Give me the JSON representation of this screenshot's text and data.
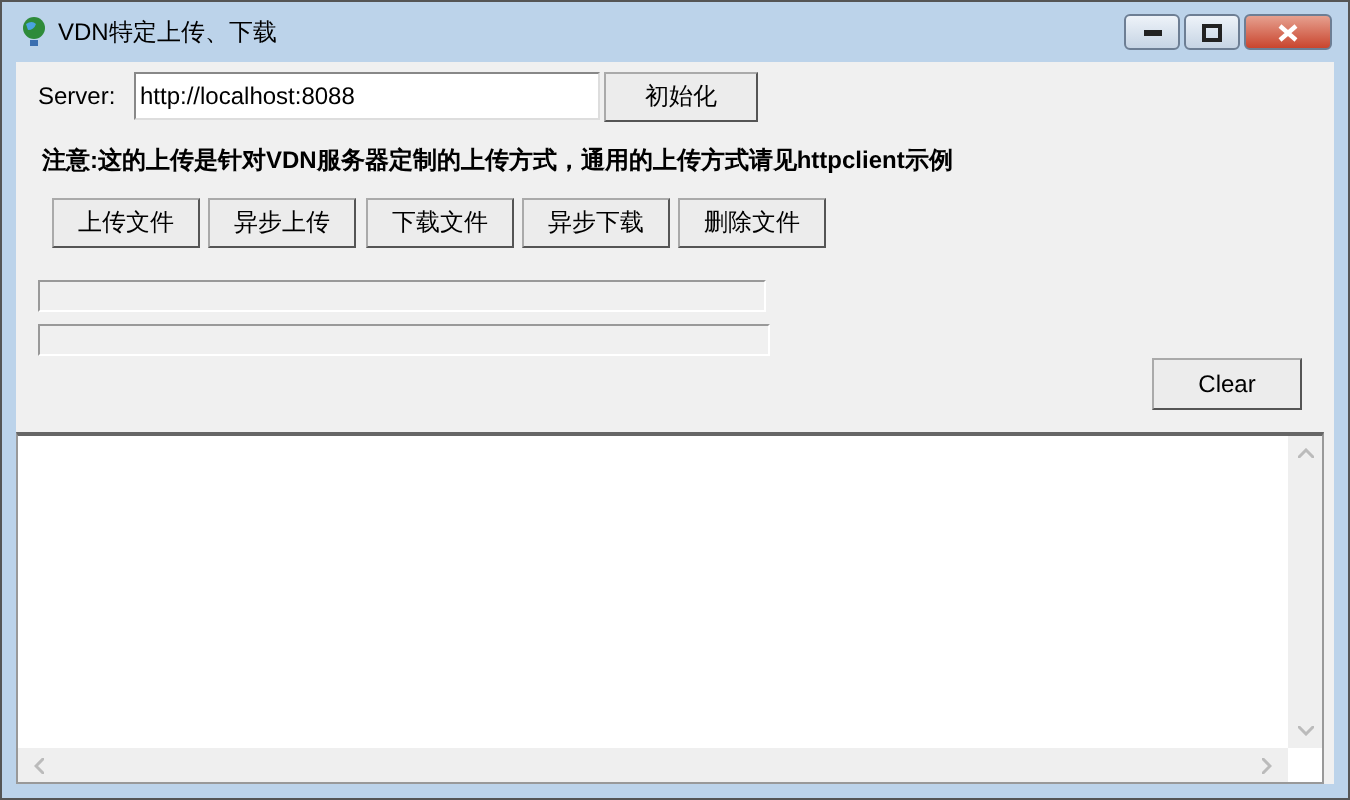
{
  "window": {
    "title": "VDN特定上传、下载"
  },
  "server": {
    "label": "Server:",
    "value": "http://localhost:8088",
    "button": "初始化"
  },
  "note": "注意:这的上传是针对VDN服务器定制的上传方式，通用的上传方式请见httpclient示例",
  "actions": [
    "上传文件",
    "异步上传",
    "下载文件",
    "异步下载",
    "删除文件"
  ],
  "progress": [
    {
      "level": 0
    },
    {
      "level": 0
    }
  ],
  "clear_button": "Clear"
}
